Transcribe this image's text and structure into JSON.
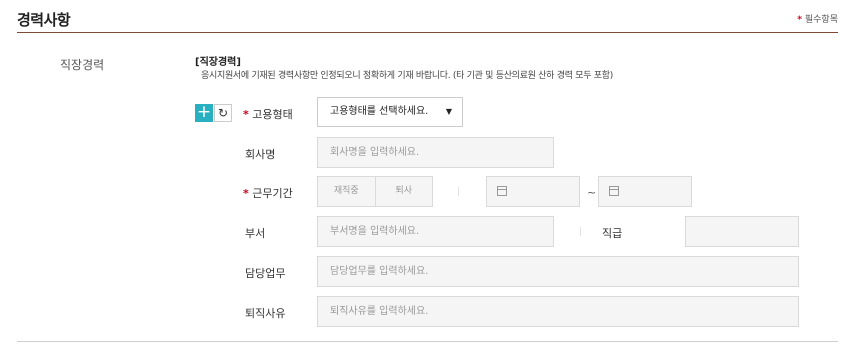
{
  "section": {
    "title": "경력사항",
    "required_note": "필수항목",
    "required_mark": "*"
  },
  "career": {
    "row_label": "직장경력",
    "sub_title": "[직장경력]",
    "description": "응시지원서에 기재된 경력사항만 인정되오니 정확하게 기재 바랍니다. (타 기관 및 등산의료원 산하 경력 모두 포함)",
    "add_icon": "plus-icon",
    "refresh_icon": "refresh-icon"
  },
  "fields": {
    "employment_type": {
      "label": "고용형태",
      "required_mark": "*",
      "selected": "고용형태를 선택하세요."
    },
    "company": {
      "label": "회사명",
      "placeholder": "회사명을 입력하세요."
    },
    "period": {
      "label": "근무기간",
      "required_mark": "*",
      "options": [
        "재직중",
        "퇴사"
      ],
      "separator": "~",
      "calendar_icon": "calendar-icon"
    },
    "department": {
      "label": "부서",
      "placeholder": "부서명을 입력하세요."
    },
    "position": {
      "label": "직급",
      "placeholder": ""
    },
    "duty": {
      "label": "담당업무",
      "placeholder": "담당업무를 입력하세요."
    },
    "leave_reason": {
      "label": "퇴직사유",
      "placeholder": "퇴직사유를 입력하세요."
    }
  },
  "colors": {
    "accent": "#29b0c0",
    "required": "#d0021b",
    "title_rule": "#7a4a35"
  }
}
